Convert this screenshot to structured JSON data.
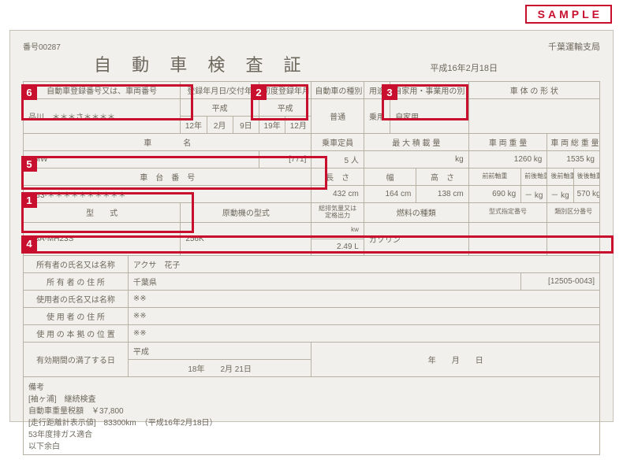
{
  "sample_label": "SAMPLE",
  "serial_prefix": "番号",
  "serial": "00287",
  "title": "自 動 車 検 査 証",
  "issue_date": "平成16年2月18日",
  "issuer": "千葉運輸支局",
  "headers": {
    "reg_no": "自動車登録番号又は、車両番号",
    "reg_date": "登録年月日/交付年",
    "first_reg": "初度登録年月",
    "vehicle_type": "自動車の種別",
    "purpose": "用途",
    "private_biz": "自家用・事業用の別",
    "body_shape": "車 体 の 形 状",
    "car_name": "車　　　　名",
    "capacity": "乗車定員",
    "max_load": "最 大 積 載 量",
    "vehicle_weight": "車 両 重 量",
    "gross_weight": "車 両 総 重 量",
    "chassis_no": "車　台　番　号",
    "length": "長　さ",
    "width": "幅",
    "height": "高　さ",
    "front_front": "前前軸重",
    "front_rear": "前後軸重",
    "rear_front": "後前軸重",
    "rear_rear": "後後軸重",
    "model": "型　　式",
    "engine_model": "原動機の型式",
    "displacement": "総排気量又は\n定格出力",
    "fuel_type": "燃料の種類",
    "model_code": "型式指定番号",
    "class_code": "類別区分番号",
    "owner_name": "所有者の氏名又は名称",
    "owner_addr": "所 有 者 の 住 所",
    "user_name": "使用者の氏名又は名称",
    "user_addr": "使 用 者 の 住 所",
    "base_loc": "使 用 の 本 拠 の 位 置",
    "expiry": "有効期間の満了する日",
    "remarks": "備考"
  },
  "values": {
    "reg_no": "品川　＊＊＊さ＊＊＊＊",
    "reg_era": "平成",
    "reg_y": "12年",
    "reg_m": "2月",
    "reg_d": "9日",
    "first_era": "平成",
    "first_y": "19年",
    "first_m": "12月",
    "vehicle_type": "普通",
    "purpose": "乗用",
    "private_biz": "自家用",
    "body_shape": "",
    "car_name": "BMW",
    "car_code": "[771]",
    "capacity": "5 人",
    "max_load": "kg",
    "vehicle_weight": "1260 kg",
    "gross_weight": "1535 kg",
    "chassis_no": "RG3-＊＊＊＊＊＊＊＊＊＊",
    "length": "432 cm",
    "width": "164 cm",
    "height": "138 cm",
    "front_front": "690 kg",
    "front_rear": "－ kg",
    "rear_front": "－ kg",
    "rear_rear": "570 kg",
    "model": "DBA-MH23S",
    "engine_model": "256K",
    "disp_unit": "kw",
    "displacement": "2.49 L",
    "fuel_type": "ガソリン",
    "owner_name": "アクサ　花子",
    "owner_addr": "千葉県",
    "owner_addr_code": "[12505-0043]",
    "user_name": "※※",
    "user_addr": "※※",
    "base_loc": "※※",
    "expiry_era": "平成",
    "expiry": "18年　　2月 21日",
    "expiry2": "年　　月　　日",
    "remarks": "[袖ヶ浦]　継続検査\n自動車重量税額　￥37,800\n[走行距離計表示値]　83300km　（平成16年2月18日）\n53年度排ガス適合\n以下余白"
  },
  "highlights": {
    "1": 1,
    "2": 2,
    "3": 3,
    "4": 4,
    "5": 5,
    "6": 6
  }
}
